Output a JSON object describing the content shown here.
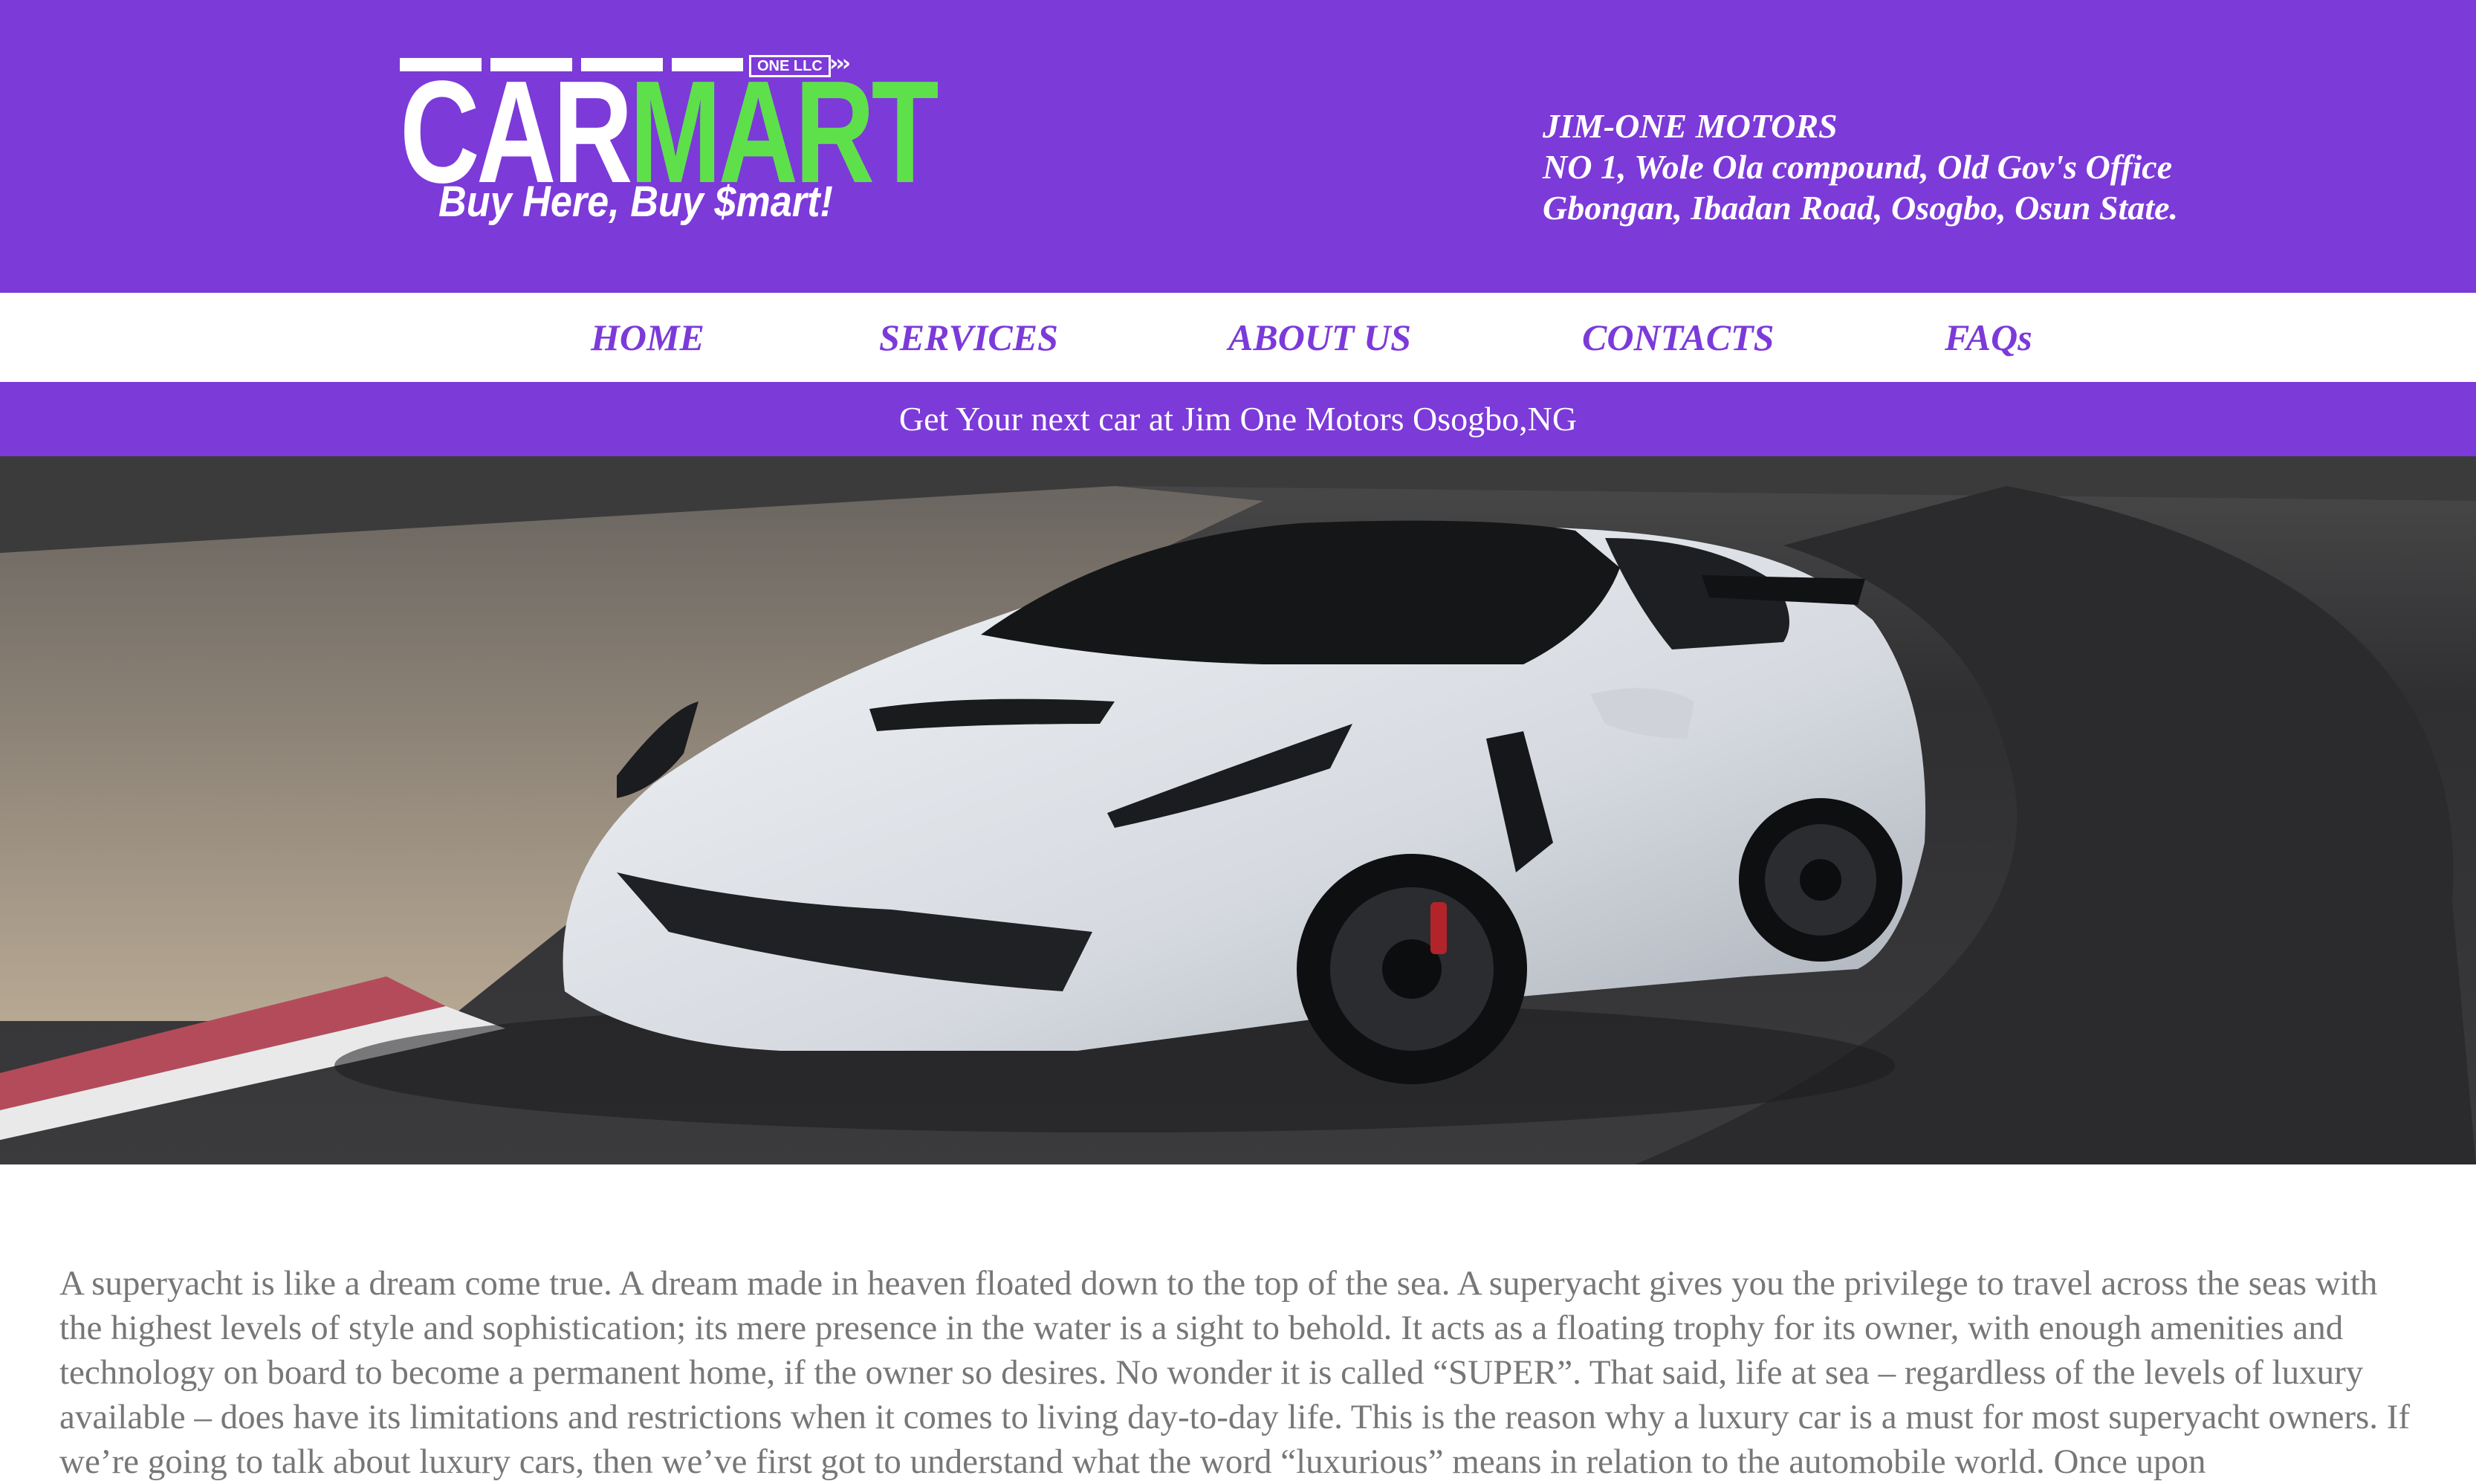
{
  "logo": {
    "brand_car": "CAR",
    "brand_mart": "MART",
    "badge": "ONE LLC",
    "tagline": "Buy Here, Buy $mart!"
  },
  "address": {
    "line1": "JIM-ONE MOTORS",
    "line2": "NO 1, Wole Ola compound, Old Gov's Office",
    "line3": "Gbongan, Ibadan Road, Osogbo, Osun State."
  },
  "nav": {
    "items": [
      {
        "label": "HOME"
      },
      {
        "label": "SERVICES"
      },
      {
        "label": "ABOUT US"
      },
      {
        "label": "CONTACTS"
      },
      {
        "label": "FAQs"
      }
    ]
  },
  "banner": {
    "text": "Get Your next car at Jim One Motors Osogbo,NG"
  },
  "article": {
    "text": "A superyacht is like a dream come true. A dream made in heaven floated down to the top of the sea. A superyacht gives you the privilege to travel across the seas with the highest levels of style and sophistication; its mere presence in the water is a sight to behold. It acts as a floating trophy for its owner, with enough amenities and technology on board to become a permanent home, if the owner so desires. No wonder it is called “SUPER”. That said, life at sea – regardless of the levels of luxury available – does have its limitations and restrictions when it comes to living day-to-day life. This is the reason why a luxury car is a must for most superyacht owners. If we’re going to talk about luxury cars, then we’ve first got to understand what the word “luxurious” means in relation to the automobile world. Once upon"
  },
  "colors": {
    "brand_purple": "#7c3ad9",
    "logo_green": "#5ee04a",
    "body_text": "#777777"
  }
}
